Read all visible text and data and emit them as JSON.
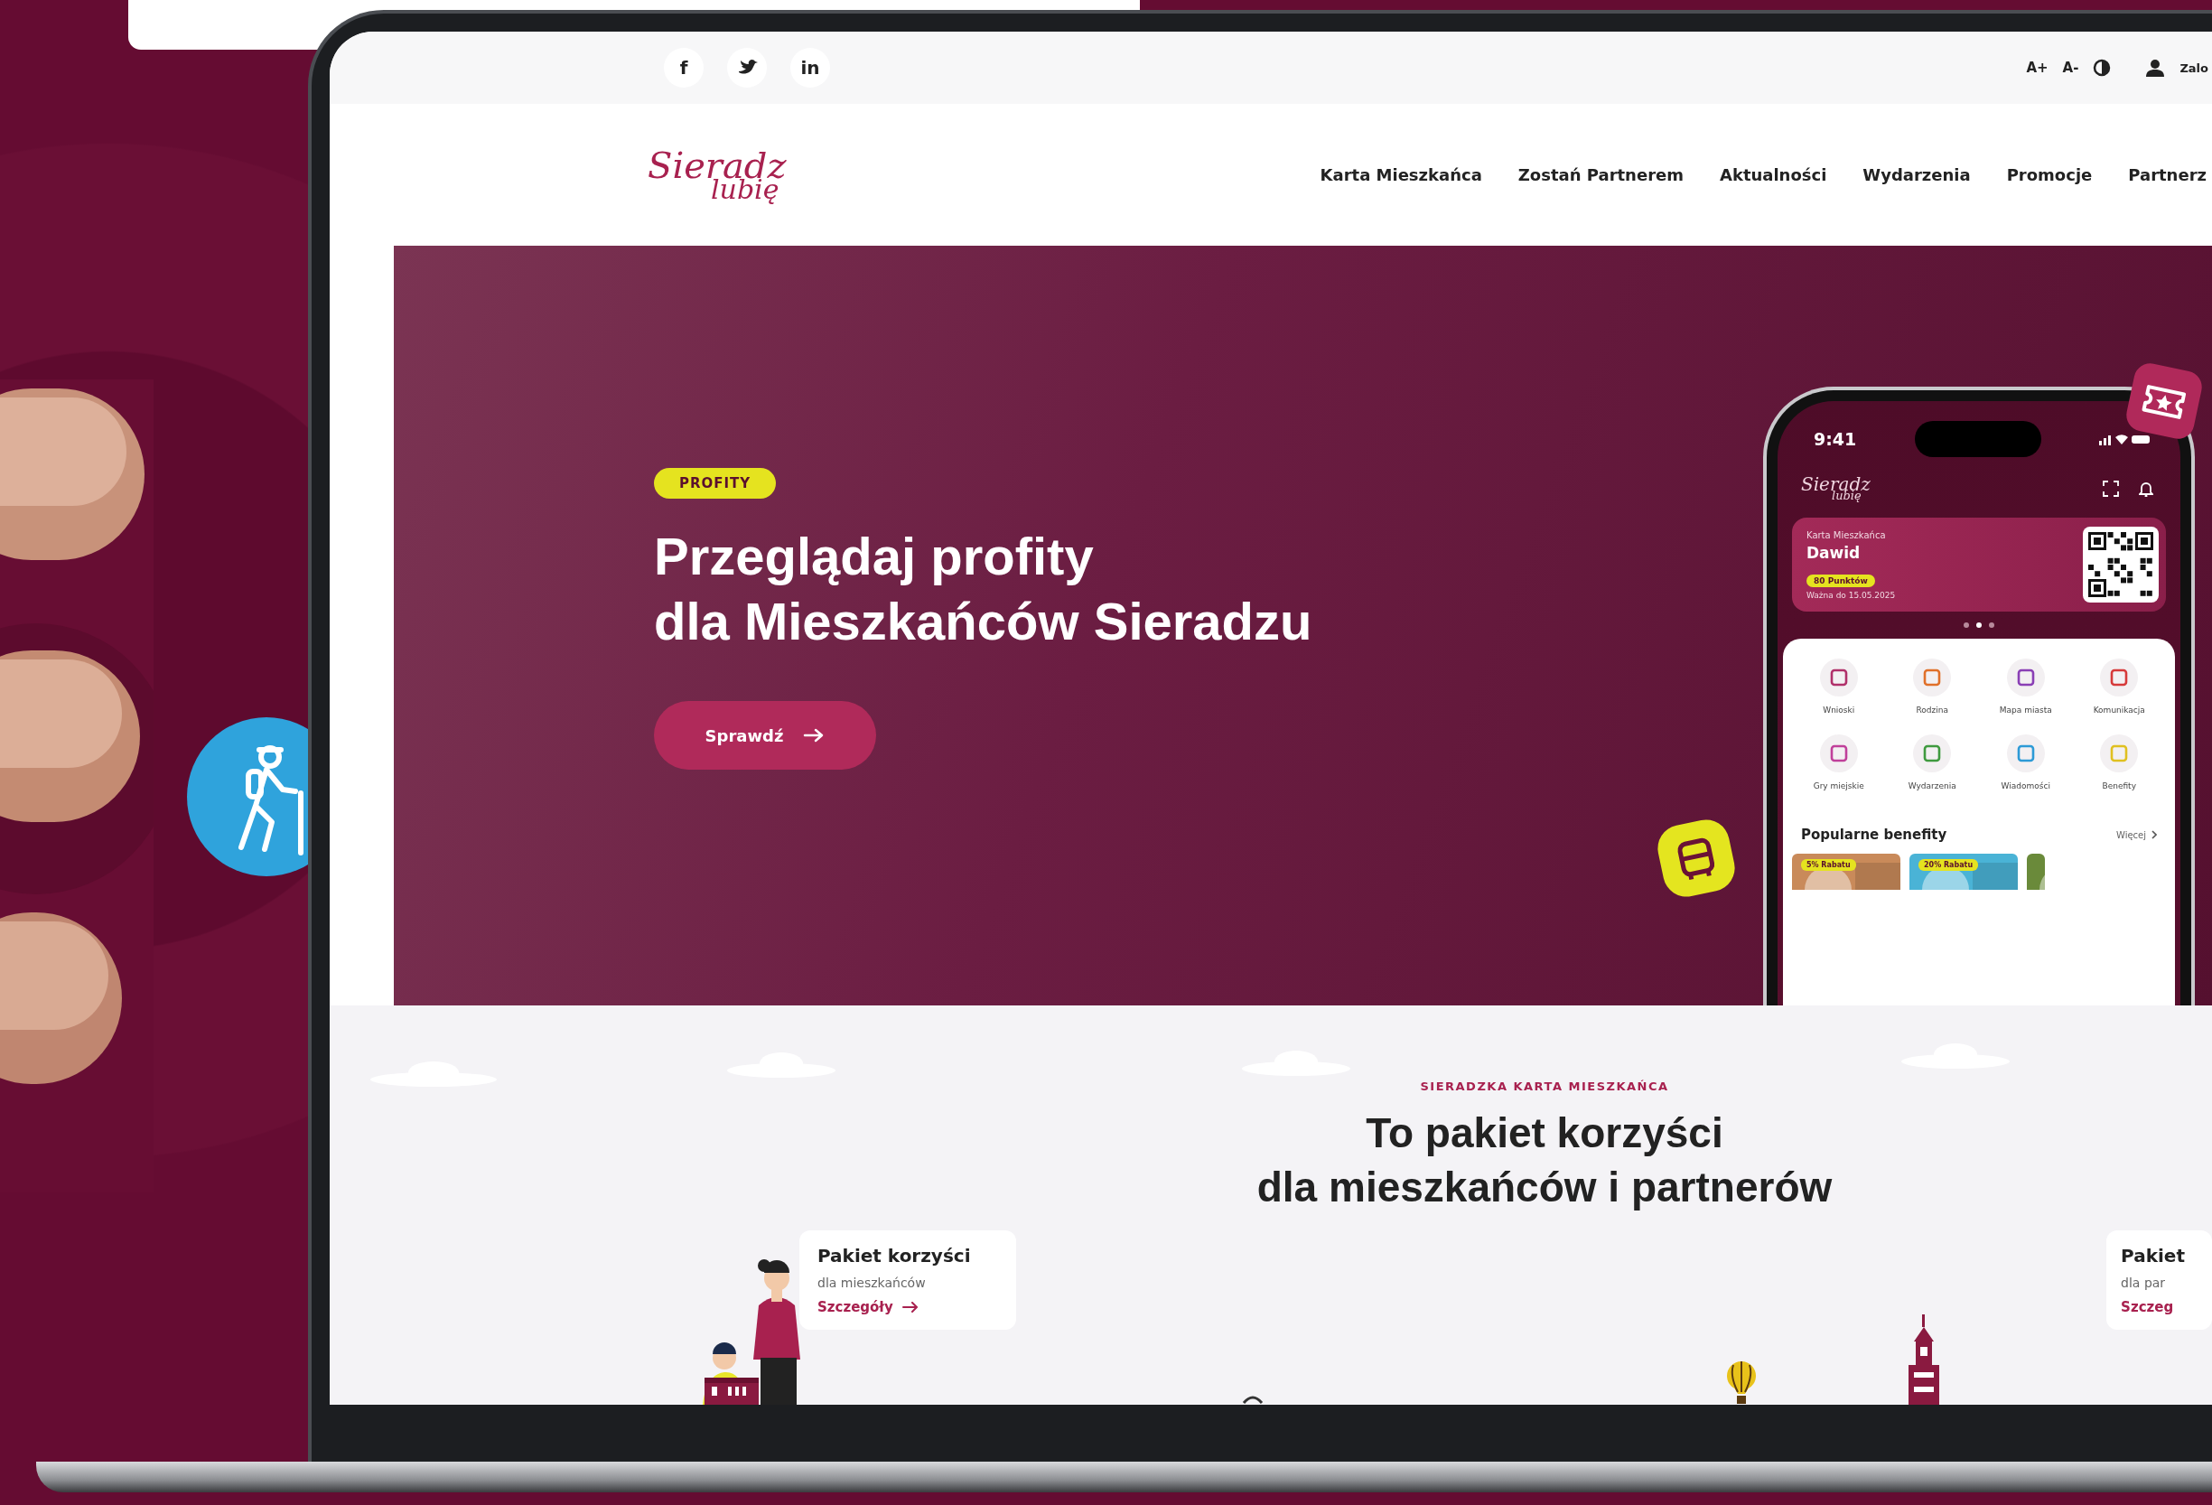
{
  "top_bar": {
    "social": [
      {
        "kind": "text",
        "label": "f"
      },
      {
        "kind": "bird"
      },
      {
        "kind": "text",
        "label": "in"
      }
    ],
    "font_up": "A+",
    "font_down": "A-",
    "login": "Zalo"
  },
  "header": {
    "logo": [
      "Sieradz",
      "lubię"
    ],
    "nav": [
      "Karta Mieszkańca",
      "Zostań Partnerem",
      "Aktualności",
      "Wydarzenia",
      "Promocje",
      "Partnerz"
    ]
  },
  "hero": {
    "badge": "PROFITY",
    "title": [
      "Przeglądaj profity",
      "dla Mieszkańców Sieradzu"
    ],
    "button": "Sprawdź",
    "phone": {
      "time": "9:41",
      "logo": [
        "Sieradz",
        "lubię"
      ],
      "card_label": "Karta Mieszkańca",
      "name": "Dawid",
      "points": "80 Punktów",
      "valid": "Ważna do 15.05.2025",
      "dots": [
        {
          "selected": false
        },
        {
          "selected": true
        },
        {
          "selected": false
        }
      ],
      "tiles": [
        {
          "label": "Wnioski",
          "color": "#b0306a"
        },
        {
          "label": "Rodzina",
          "color": "#e0702a"
        },
        {
          "label": "Mapa miasta",
          "color": "#8a3fb5"
        },
        {
          "label": "Komunikacja",
          "color": "#d63a3a"
        },
        {
          "label": "Gry miejskie",
          "color": "#c0409a"
        },
        {
          "label": "Wydarzenia",
          "color": "#3f9a3f"
        },
        {
          "label": "Wiadomości",
          "color": "#2d9ad6"
        },
        {
          "label": "Benefity",
          "color": "#e0c020"
        }
      ],
      "benefits_title": "Popularne benefity",
      "more": "Więcej",
      "benefits": [
        {
          "badge": "5% Rabatu",
          "color": "#c98a5a"
        },
        {
          "badge": "20% Rabatu",
          "color": "#4ab3d6"
        },
        {
          "color": "#6a8a3a"
        }
      ]
    }
  },
  "section": {
    "eyebrow": "SIERADZKA KARTA MIESZKAŃCA",
    "title": [
      "To pakiet korzyści",
      "dla mieszkańców i partnerów"
    ],
    "cards": [
      {
        "title": "Pakiet korzyści",
        "subtitle": "dla mieszkańców",
        "link": "Szczegóły"
      },
      {
        "title": "Pakiet",
        "subtitle": "dla par",
        "link": "Szczeg"
      }
    ]
  }
}
